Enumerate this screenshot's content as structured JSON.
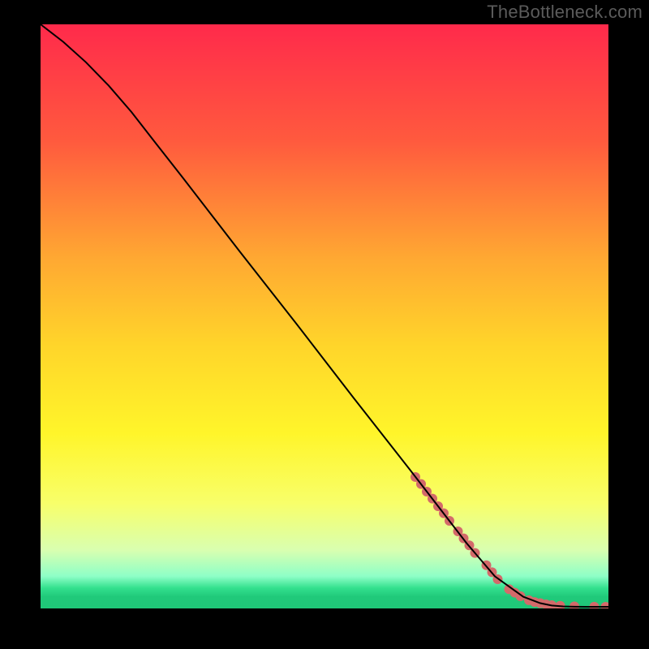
{
  "watermark": "TheBottleneck.com",
  "chart_data": {
    "type": "line",
    "title": "",
    "xlabel": "",
    "ylabel": "",
    "xlim": [
      0,
      100
    ],
    "ylim": [
      0,
      100
    ],
    "grid": false,
    "legend": false,
    "background_gradient": {
      "stops": [
        {
          "offset": 0.0,
          "color": "#ff2a4b"
        },
        {
          "offset": 0.2,
          "color": "#ff5a3e"
        },
        {
          "offset": 0.4,
          "color": "#ffa832"
        },
        {
          "offset": 0.55,
          "color": "#ffd52a"
        },
        {
          "offset": 0.7,
          "color": "#fff52a"
        },
        {
          "offset": 0.82,
          "color": "#f8ff6a"
        },
        {
          "offset": 0.9,
          "color": "#d9ffb0"
        },
        {
          "offset": 0.945,
          "color": "#8effc7"
        },
        {
          "offset": 0.965,
          "color": "#33e08e"
        },
        {
          "offset": 0.98,
          "color": "#20c97a"
        },
        {
          "offset": 1.0,
          "color": "#1fc878"
        }
      ]
    },
    "series": [
      {
        "name": "curve",
        "type": "line",
        "color": "#000000",
        "x": [
          0,
          4,
          8,
          12,
          16,
          20,
          25,
          30,
          35,
          40,
          45,
          50,
          55,
          60,
          65,
          70,
          75,
          80,
          85,
          88,
          90,
          92,
          94,
          96,
          98,
          100
        ],
        "y": [
          100,
          97,
          93.5,
          89.5,
          85,
          80,
          73.8,
          67.5,
          61.2,
          55,
          48.8,
          42.5,
          36.2,
          30,
          23.8,
          17.5,
          11.2,
          5.5,
          2.0,
          0.9,
          0.5,
          0.35,
          0.3,
          0.28,
          0.27,
          0.27
        ]
      },
      {
        "name": "markers",
        "type": "scatter",
        "color": "#d36a6a",
        "radius": 6,
        "x": [
          66,
          67,
          68,
          69,
          70,
          71,
          72,
          73.5,
          74.5,
          75.5,
          76.5,
          78.5,
          79.5,
          80.5,
          82.5,
          83.5,
          84.5,
          86,
          87,
          88,
          89,
          90,
          91.5,
          94,
          97.5,
          99.5
        ],
        "y": [
          22.5,
          21.3,
          20.0,
          18.8,
          17.5,
          16.3,
          15.0,
          13.2,
          12.0,
          10.8,
          9.5,
          7.4,
          6.2,
          5.0,
          3.3,
          2.7,
          2.1,
          1.4,
          1.1,
          0.9,
          0.7,
          0.55,
          0.45,
          0.35,
          0.3,
          0.28
        ]
      }
    ]
  }
}
